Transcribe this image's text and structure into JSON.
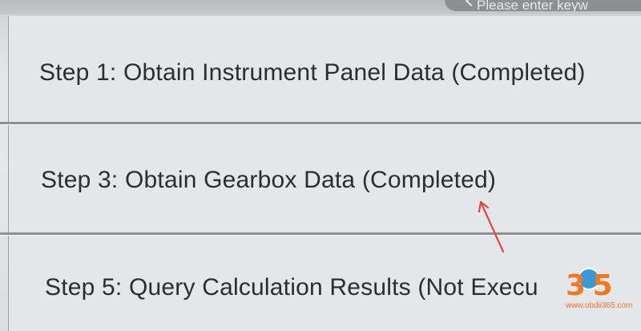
{
  "search": {
    "placeholder": "Please enter keyw"
  },
  "steps": [
    {
      "label": "Step 1: Obtain Instrument Panel Data (Completed)"
    },
    {
      "label": "Step 3: Obtain Gearbox Data (Completed)"
    },
    {
      "label": "Step 5: Query Calculation Results (Not Execu"
    }
  ],
  "watermark": {
    "logo_text": "3 5",
    "url": "www.obdii365.com"
  },
  "colors": {
    "annotation_arrow": "#e0483e",
    "watermark_orange": "#f07a22",
    "watermark_blue": "#3a9ad9"
  }
}
